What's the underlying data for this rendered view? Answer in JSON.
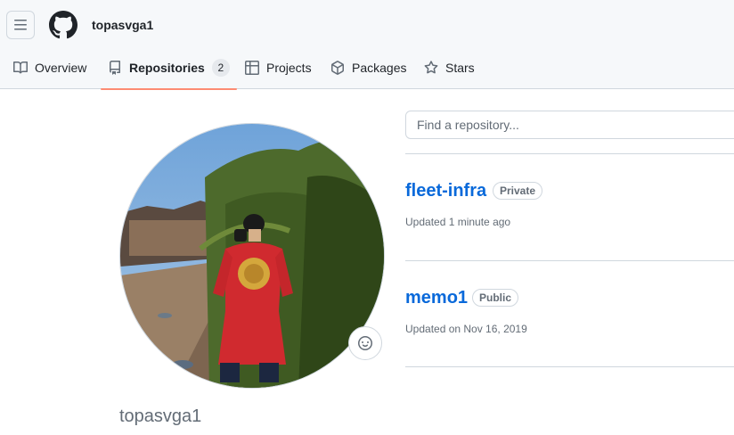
{
  "header": {
    "username": "topasvga1",
    "icons": {
      "menu": "hamburger-menu-icon",
      "logo": "github-logo-icon"
    }
  },
  "tabs": [
    {
      "label": "Overview",
      "icon": "book-icon"
    },
    {
      "label": "Repositories",
      "icon": "repo-icon",
      "count": "2",
      "active": true
    },
    {
      "label": "Projects",
      "icon": "table-icon"
    },
    {
      "label": "Packages",
      "icon": "package-icon"
    },
    {
      "label": "Stars",
      "icon": "star-icon"
    }
  ],
  "profile": {
    "name": "topasvga1",
    "status_icon": "smiley-icon"
  },
  "search": {
    "placeholder": "Find a repository..."
  },
  "repos": [
    {
      "name": "fleet-infra",
      "visibility": "Private",
      "updated": "Updated 1 minute ago"
    },
    {
      "name": "memo1",
      "visibility": "Public",
      "updated": "Updated on Nov 16, 2019"
    }
  ],
  "colors": {
    "link": "#0969da",
    "active_tab_underline": "#fd8c73",
    "muted_text": "#636c76",
    "border": "#d0d7de",
    "header_bg": "#f6f8fa"
  }
}
